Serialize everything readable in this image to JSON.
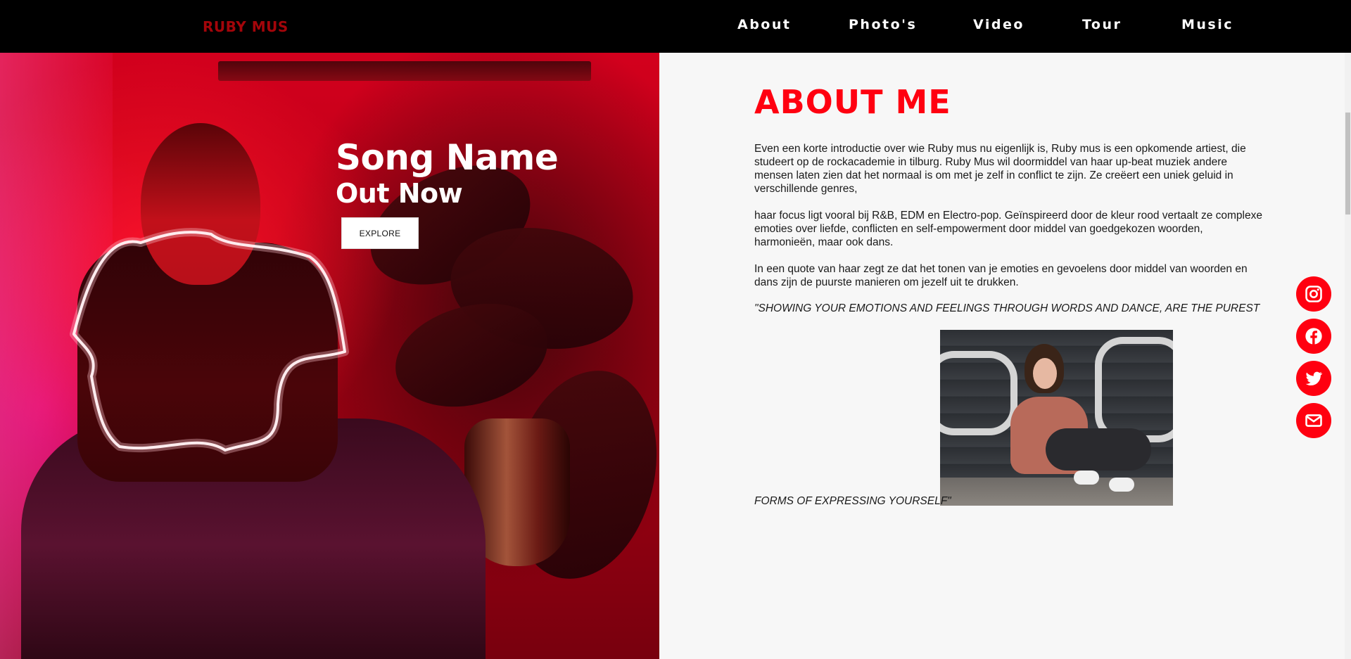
{
  "nav": {
    "brand": "RUBY MUS",
    "links": [
      "About",
      "Photo's",
      "Video",
      "Tour",
      "Music"
    ]
  },
  "hero": {
    "title": "Song Name",
    "subtitle": "Out Now",
    "button_label": "EXPLORE"
  },
  "about": {
    "heading": "ABOUT ME",
    "paragraphs": [
      "Even een korte introductie over wie Ruby mus nu eigenlijk is, Ruby mus is een opkomende artiest, die studeert op de rockacademie in tilburg. Ruby Mus wil doormiddel van haar up-beat muziek andere mensen laten zien dat het normaal is om met je zelf in conflict te zijn. Ze creëert een uniek geluid in verschillende genres,",
      "haar focus ligt vooral bij R&B, EDM en Electro-pop. Geïnspireerd door de kleur rood vertaalt ze complexe emoties over liefde, conflicten en self-empowerment door middel van goedgekozen woorden, harmonieën, maar ook dans.",
      "In een quote van haar zegt ze dat het tonen van je emoties en gevoelens door middel van woorden en dans zijn de puurste manieren om jezelf uit te drukken."
    ],
    "quote_line1": "\"SHOWING YOUR EMOTIONS AND FEELINGS THROUGH WORDS AND DANCE, ARE THE PUREST",
    "quote_line2": "FORMS OF EXPRESSING YOURSELF\""
  },
  "social": [
    "instagram-icon",
    "facebook-icon",
    "twitter-icon",
    "mail-icon"
  ],
  "colors": {
    "accent": "#ff0010",
    "brand": "#a3050a",
    "nav_bg": "#000000"
  }
}
